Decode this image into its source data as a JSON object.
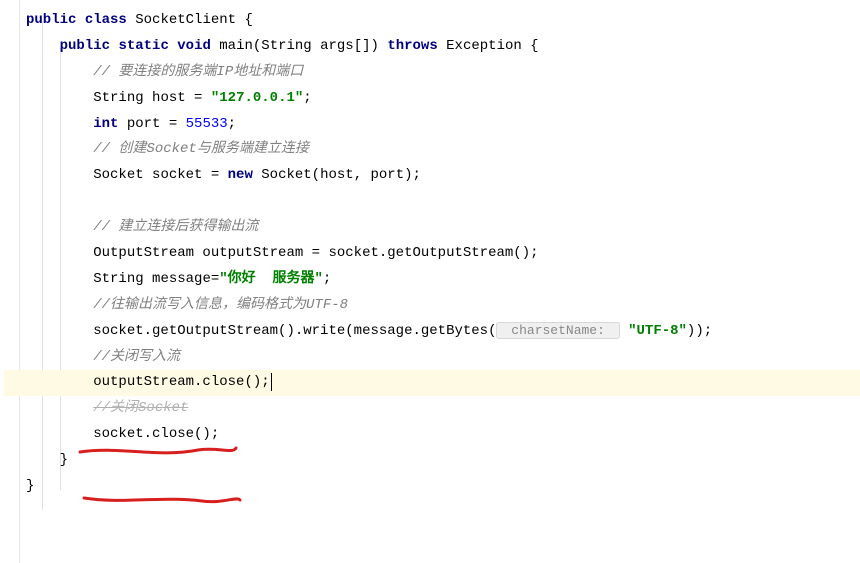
{
  "code": {
    "l1": {
      "kw_public": "public",
      "kw_class": "class",
      "class_name": "SocketClient",
      "brace": " {"
    },
    "l2": {
      "kw_public": "public",
      "kw_static": "static",
      "kw_void": "void",
      "method": "main",
      "params": "(String args[])",
      "kw_throws": "throws",
      "exception": "Exception",
      "brace": " {"
    },
    "l3": {
      "comment": "// 要连接的服务端IP地址和端口"
    },
    "l4": {
      "type": "String",
      "var": " host = ",
      "str": "\"127.0.0.1\"",
      "semi": ";"
    },
    "l5": {
      "kw_int": "int",
      "var": " port = ",
      "num": "55533",
      "semi": ";"
    },
    "l6": {
      "comment": "// 创建Socket与服务端建立连接"
    },
    "l7": {
      "type": "Socket",
      "var": " socket = ",
      "kw_new": "new",
      "ctor": " Socket(host, port);"
    },
    "l8": {
      "blank": ""
    },
    "l9": {
      "comment": "// 建立连接后获得输出流"
    },
    "l10": {
      "text": "OutputStream outputStream = socket.getOutputStream();"
    },
    "l11": {
      "type": "String",
      "var": " message=",
      "str": "\"你好  服务器\"",
      "semi": ";"
    },
    "l12": {
      "comment": "//往输出流写入信息，编码格式为UTF-8"
    },
    "l13": {
      "pre": "socket.getOutputStream().write(message.getBytes(",
      "hint": " charsetName: ",
      "str": "\"UTF-8\"",
      "post": "));"
    },
    "l14": {
      "comment": "//关闭写入流"
    },
    "l15": {
      "text": "outputStream.close();"
    },
    "l16": {
      "struck": "//关闭Socket"
    },
    "l17": {
      "text": "socket.close();"
    },
    "l18": {
      "brace": "}"
    },
    "l19": {
      "brace": "}"
    }
  },
  "indent": {
    "i1": "",
    "i2": "    ",
    "i3": "        "
  }
}
